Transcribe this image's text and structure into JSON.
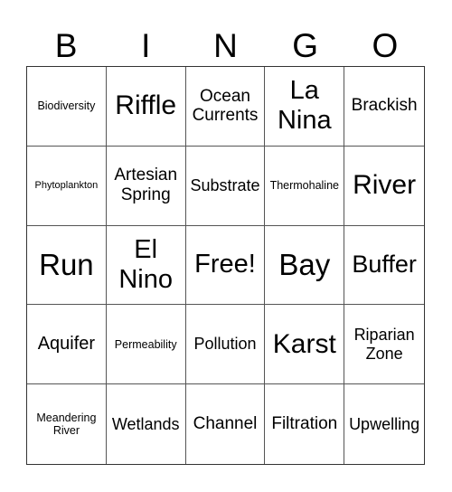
{
  "header": [
    "B",
    "I",
    "N",
    "G",
    "O"
  ],
  "cells": [
    "Biodiversity",
    "Riffle",
    "Ocean Currents",
    "La Nina",
    "Brackish",
    "Phytoplankton",
    "Artesian Spring",
    "Substrate",
    "Thermohaline",
    "River",
    "Run",
    "El Nino",
    "Free!",
    "Bay",
    "Buffer",
    "Aquifer",
    "Permeability",
    "Pollution",
    "Karst",
    "Riparian Zone",
    "Meandering River",
    "Wetlands",
    "Channel",
    "Filtration",
    "Upwelling"
  ]
}
